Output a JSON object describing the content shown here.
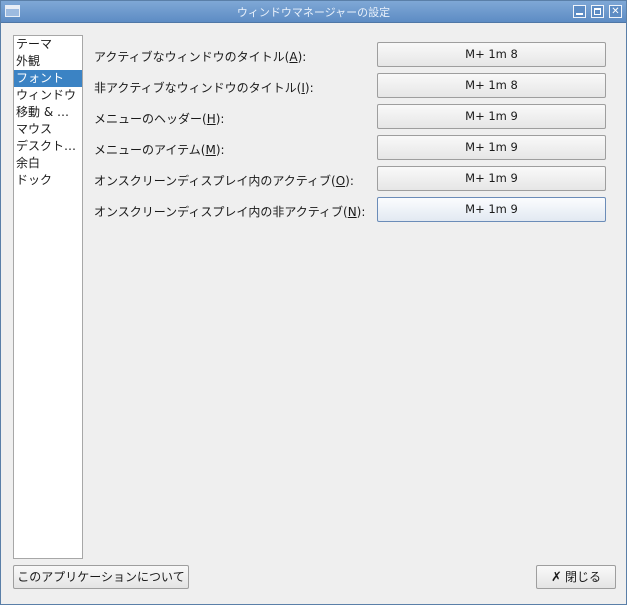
{
  "window": {
    "title": "ウィンドウマネージャーの設定"
  },
  "sidebar": {
    "items": [
      {
        "label": "テーマ"
      },
      {
        "label": "外観"
      },
      {
        "label": "フォント"
      },
      {
        "label": "ウィンドウ"
      },
      {
        "label": "移動 & …"
      },
      {
        "label": "マウス"
      },
      {
        "label": "デスクト…"
      },
      {
        "label": "余白"
      },
      {
        "label": "ドック"
      }
    ],
    "selected": "フォント"
  },
  "fonts": {
    "rows": [
      {
        "label_pre": "アクティブなウィンドウのタイトル(",
        "mnemonic": "A",
        "label_post": "):",
        "value": "M+ 1m 8"
      },
      {
        "label_pre": "非アクティブなウィンドウのタイトル(",
        "mnemonic": "I",
        "label_post": "):",
        "value": "M+ 1m 8"
      },
      {
        "label_pre": "メニューのヘッダー(",
        "mnemonic": "H",
        "label_post": "):",
        "value": "M+ 1m 9"
      },
      {
        "label_pre": "メニューのアイテム(",
        "mnemonic": "M",
        "label_post": "):",
        "value": "M+ 1m 9"
      },
      {
        "label_pre": "オンスクリーンディスプレイ内のアクティブ(",
        "mnemonic": "O",
        "label_post": "):",
        "value": "M+ 1m 9"
      },
      {
        "label_pre": "オンスクリーンディスプレイ内の非アクティブ(",
        "mnemonic": "N",
        "label_post": "):",
        "value": "M+ 1m 9"
      }
    ]
  },
  "footer": {
    "about_label": "このアプリケーションについて",
    "close_icon": "✗",
    "close_label": "閉じる"
  }
}
